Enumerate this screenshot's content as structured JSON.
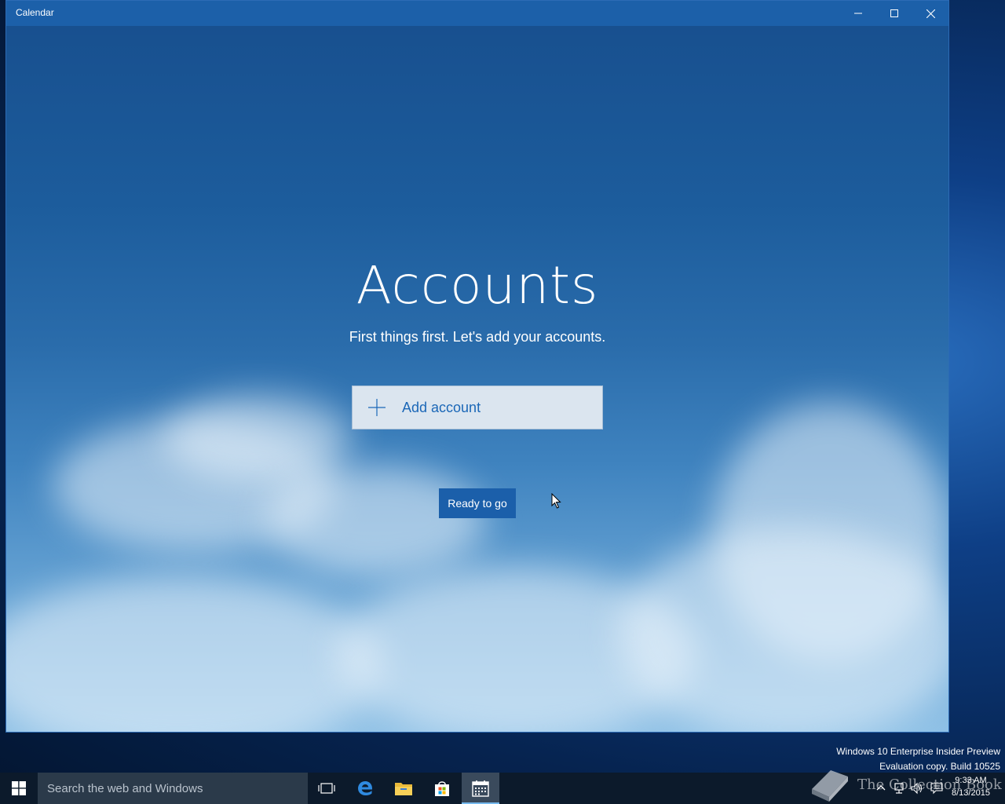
{
  "window": {
    "title": "Calendar"
  },
  "accounts": {
    "heading": "Accounts",
    "subtitle": "First things first. Let's add your accounts.",
    "add_account_label": "Add account",
    "ready_label": "Ready to go"
  },
  "watermark": {
    "line1": "Windows 10 Enterprise Insider Preview",
    "line2": "Evaluation copy. Build 10525"
  },
  "taskbar": {
    "search_placeholder": "Search the web and Windows",
    "pinned": [
      "task-view",
      "edge",
      "file-explorer",
      "store",
      "calendar"
    ],
    "active_app": "calendar",
    "brand_text": "The Collection Book",
    "clock_time": "9:33 AM",
    "clock_date": "8/13/2015"
  },
  "colors": {
    "titlebar": "#1c60a9",
    "accent": "#1b5faa",
    "add_account_text": "#1b67b7",
    "taskbar": "#0c1a2b"
  }
}
